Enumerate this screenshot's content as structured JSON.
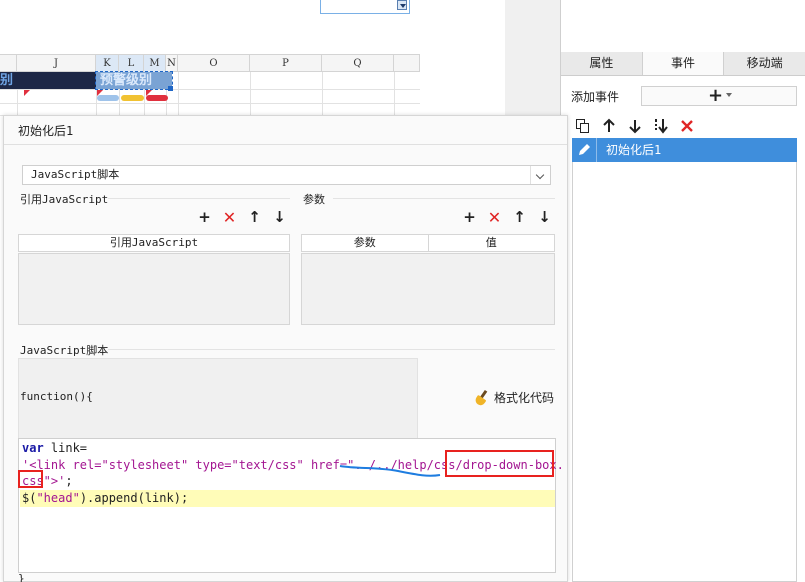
{
  "sheet": {
    "columns": [
      {
        "label": "",
        "w": 17
      },
      {
        "label": "J",
        "w": 79
      },
      {
        "label": "K",
        "w": 23
      },
      {
        "label": "L",
        "w": 25
      },
      {
        "label": "M",
        "w": 22
      },
      {
        "label": "N",
        "w": 12
      },
      {
        "label": "O",
        "w": 72
      },
      {
        "label": "P",
        "w": 72
      },
      {
        "label": "Q",
        "w": 72
      },
      {
        "label": "",
        "w": 26
      }
    ],
    "navy_cell_text": "别",
    "selected_cell_text": "预警级别"
  },
  "panel": {
    "tabs": [
      "属性",
      "事件",
      "移动端"
    ],
    "active_tab": 1,
    "add_event_label": "添加事件",
    "event_items": [
      "初始化后1"
    ]
  },
  "dialog": {
    "title": "初始化后1",
    "script_type": "JavaScript脚本",
    "ref_section_label": "引用JavaScript",
    "params_section_label": "参数",
    "ref_table_header": "引用JavaScript",
    "params_table_headers": [
      "参数",
      "值"
    ],
    "script_section_label": "JavaScript脚本",
    "function_header": "function(){",
    "format_button_label": "格式化代码",
    "closing_brace": "}",
    "code": {
      "l1_kw": "var",
      "l1_rest": " link=",
      "l2": "'<link rel=\"stylesheet\" type=\"text/css\" href=\"../../help/css/drop-down-box.",
      "l3_str": "css\">'",
      "l3_rest": ";",
      "l4_a": "$(",
      "l4_str": "\"head\"",
      "l4_b": ").append(link);"
    }
  },
  "colors": {
    "accent": "#3f8edc",
    "annotation_red": "#e8221f",
    "annotation_blue": "#1e7de0"
  }
}
